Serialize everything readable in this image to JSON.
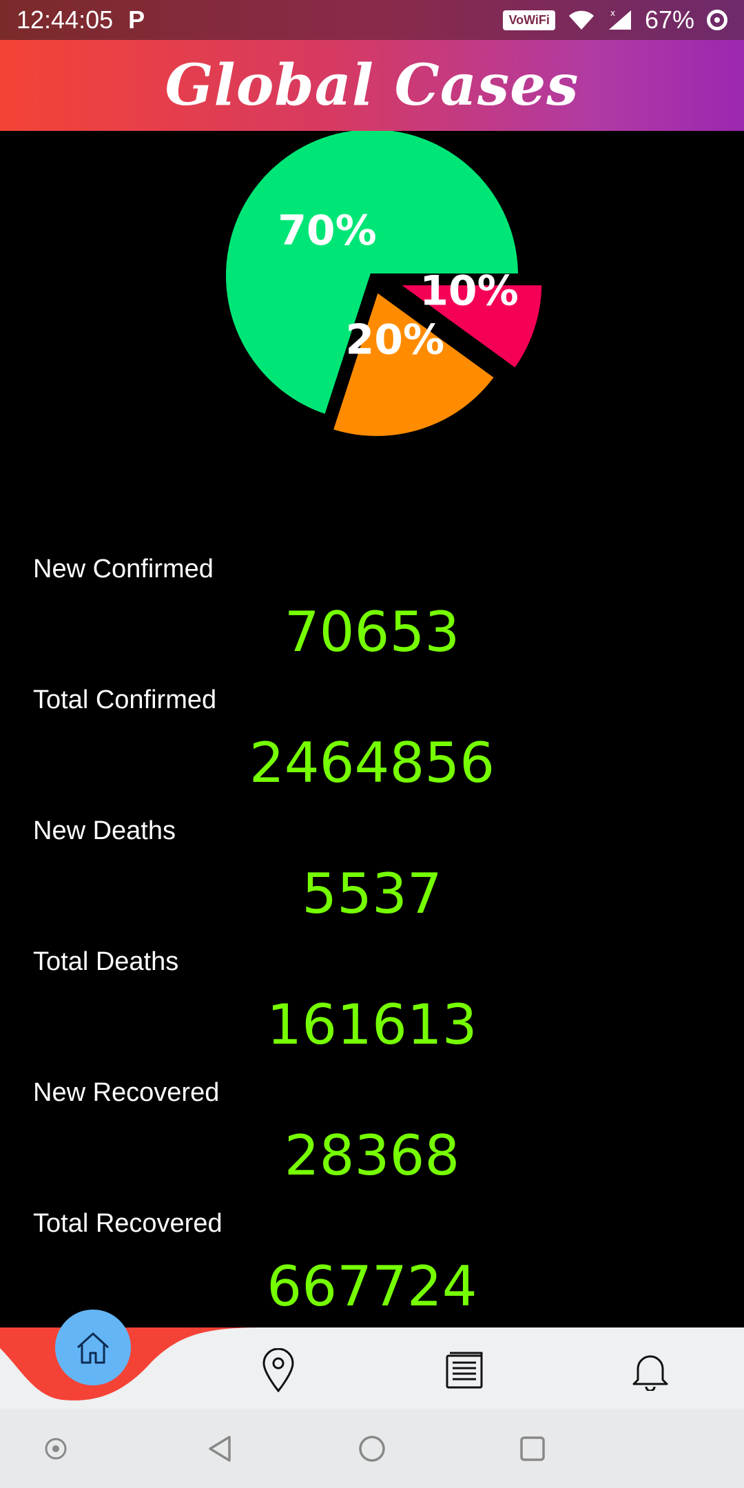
{
  "status_bar": {
    "time": "12:44:05",
    "app_icon": "P",
    "vowifi_label": "VoWiFi",
    "battery": "67%"
  },
  "header": {
    "title": "Global Cases"
  },
  "chart_data": {
    "type": "pie",
    "slices": [
      {
        "label": "70%",
        "value": 70,
        "color": "#00e676"
      },
      {
        "label": "20%",
        "value": 20,
        "color": "#ff8c00"
      },
      {
        "label": "10%",
        "value": 10,
        "color": "#f50057"
      }
    ]
  },
  "stats": [
    {
      "label": "New Confirmed",
      "value": "70653"
    },
    {
      "label": "Total Confirmed",
      "value": "2464856"
    },
    {
      "label": "New Deaths",
      "value": "5537"
    },
    {
      "label": "Total Deaths",
      "value": "161613"
    },
    {
      "label": "New Recovered",
      "value": "28368"
    },
    {
      "label": "Total Recovered",
      "value": "667724"
    }
  ],
  "bottom_nav": {
    "items": [
      {
        "name": "home",
        "icon": "home-icon"
      },
      {
        "name": "location",
        "icon": "location-pin-icon"
      },
      {
        "name": "news",
        "icon": "newspaper-icon"
      },
      {
        "name": "notifications",
        "icon": "bell-icon"
      }
    ],
    "accent_color": "#f44336",
    "active_color": "#64b5f6"
  },
  "system_nav": [
    "assistant-icon",
    "back-icon",
    "home-circle-icon",
    "recents-icon"
  ]
}
